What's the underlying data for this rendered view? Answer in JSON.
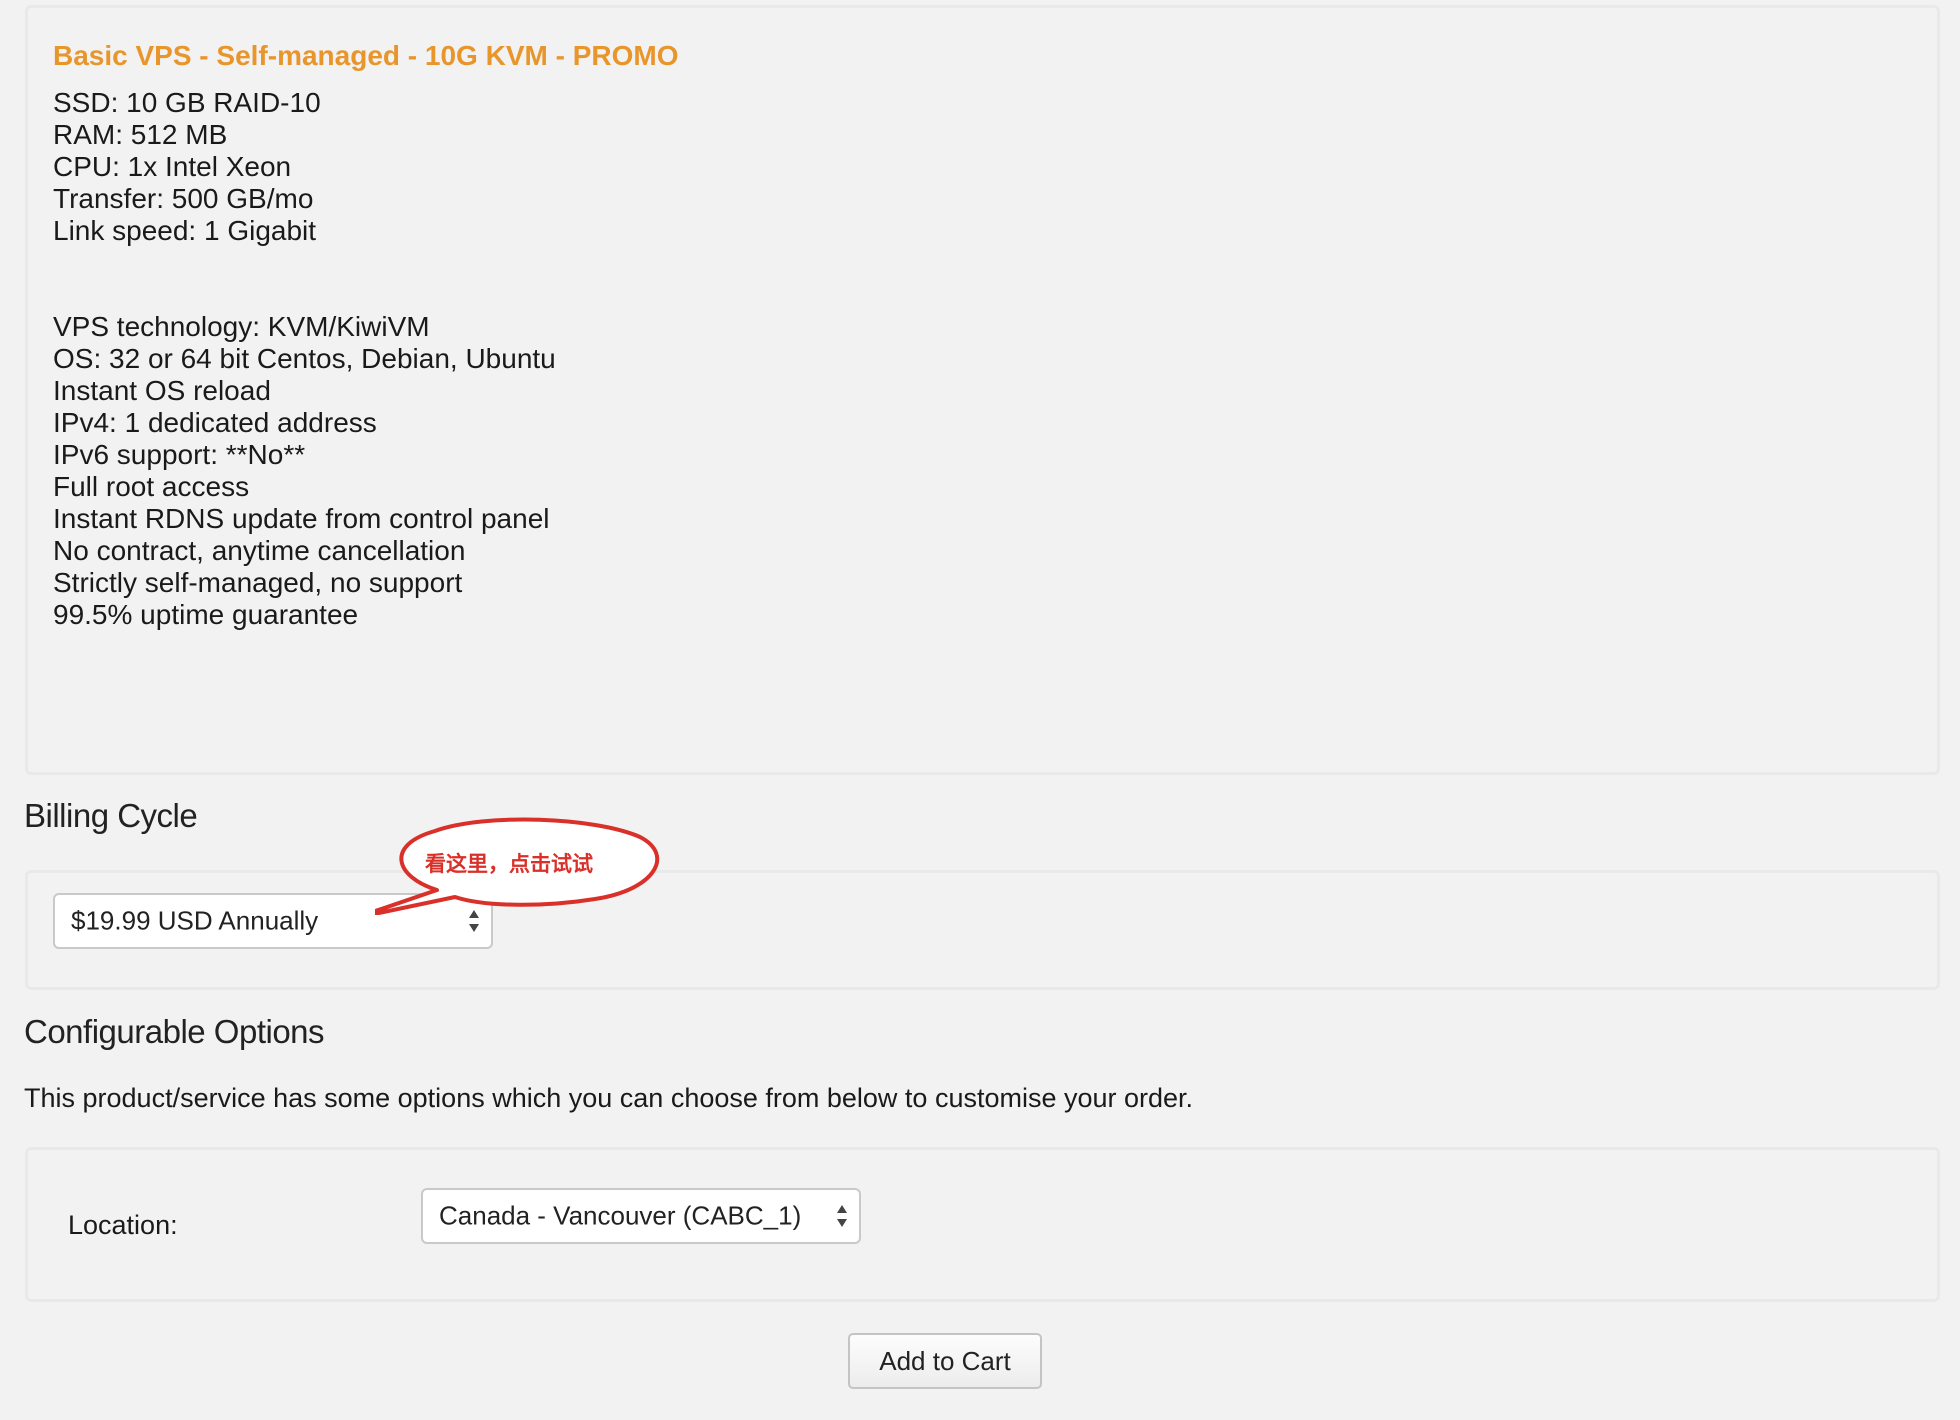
{
  "product": {
    "title": "Basic VPS - Self-managed - 10G KVM - PROMO",
    "specs": [
      "SSD: 10 GB RAID-10",
      "RAM: 512 MB",
      "CPU: 1x Intel Xeon",
      "Transfer: 500 GB/mo",
      "Link speed: 1 Gigabit"
    ],
    "features": [
      "VPS technology: KVM/KiwiVM",
      "OS: 32 or 64 bit Centos, Debian, Ubuntu",
      "Instant OS reload",
      "IPv4: 1 dedicated address",
      "IPv6 support: **No**",
      "Full root access",
      "Instant RDNS update from control panel",
      "No contract, anytime cancellation",
      "Strictly self-managed, no support",
      "99.5% uptime guarantee"
    ]
  },
  "billing": {
    "heading": "Billing Cycle",
    "selected": "$19.99 USD Annually",
    "callout": "看这里，点击试试",
    "callout_color": "#d9302a"
  },
  "config": {
    "heading": "Configurable Options",
    "description": "This product/service has some options which you can choose from below to customise your order.",
    "location_label": "Location:",
    "location_selected": "Canada - Vancouver (CABC_1)"
  },
  "actions": {
    "add_to_cart": "Add to Cart"
  },
  "colors": {
    "title_accent": "#e8962c",
    "background": "#f2f2f2"
  }
}
